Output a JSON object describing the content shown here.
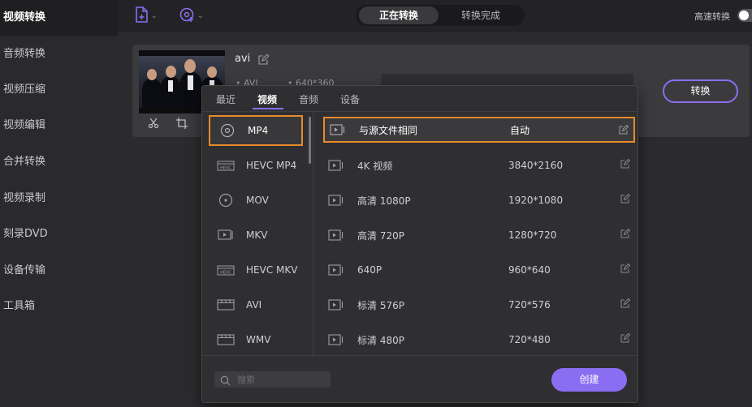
{
  "sidebar": {
    "items": [
      {
        "label": "视频转换",
        "active": true
      },
      {
        "label": "音频转换"
      },
      {
        "label": "视频压缩"
      },
      {
        "label": "视频编辑"
      },
      {
        "label": "合并转换"
      },
      {
        "label": "视频录制"
      },
      {
        "label": "刻录DVD"
      },
      {
        "label": "设备传输"
      },
      {
        "label": "工具箱"
      }
    ]
  },
  "topbar": {
    "add_file_icon": "add-file-icon",
    "add_media_icon": "add-media-icon",
    "tabs": [
      {
        "label": "正在转换",
        "active": true
      },
      {
        "label": "转换完成"
      }
    ],
    "high_speed_label": "高速转换"
  },
  "task": {
    "file_name": "avi",
    "format": "AVI",
    "resolution": "640*360",
    "convert_label": "转换"
  },
  "popup": {
    "tabs": [
      {
        "label": "最近"
      },
      {
        "label": "视频",
        "active": true
      },
      {
        "label": "音频"
      },
      {
        "label": "设备"
      }
    ],
    "formats": [
      {
        "label": "MP4",
        "icon": "disc-icon",
        "selected": true
      },
      {
        "label": "HEVC MP4",
        "icon": "hevc-icon"
      },
      {
        "label": "MOV",
        "icon": "disc-icon"
      },
      {
        "label": "MKV",
        "icon": "mkv-icon"
      },
      {
        "label": "HEVC MKV",
        "icon": "hevc-icon"
      },
      {
        "label": "AVI",
        "icon": "clapper-icon"
      },
      {
        "label": "WMV",
        "icon": "clapper-icon"
      }
    ],
    "resolutions": [
      {
        "name": "与源文件相同",
        "value": "自动",
        "selected": true
      },
      {
        "name": "4K 视频",
        "value": "3840*2160"
      },
      {
        "name": "高清 1080P",
        "value": "1920*1080"
      },
      {
        "name": "高清 720P",
        "value": "1280*720"
      },
      {
        "name": "640P",
        "value": "960*640"
      },
      {
        "name": "标清 576P",
        "value": "720*576"
      },
      {
        "name": "标清 480P",
        "value": "720*480"
      }
    ],
    "search_placeholder": "搜索",
    "create_label": "创建"
  },
  "colors": {
    "accent": "#8a6df1",
    "highlight": "#e88a2a"
  }
}
